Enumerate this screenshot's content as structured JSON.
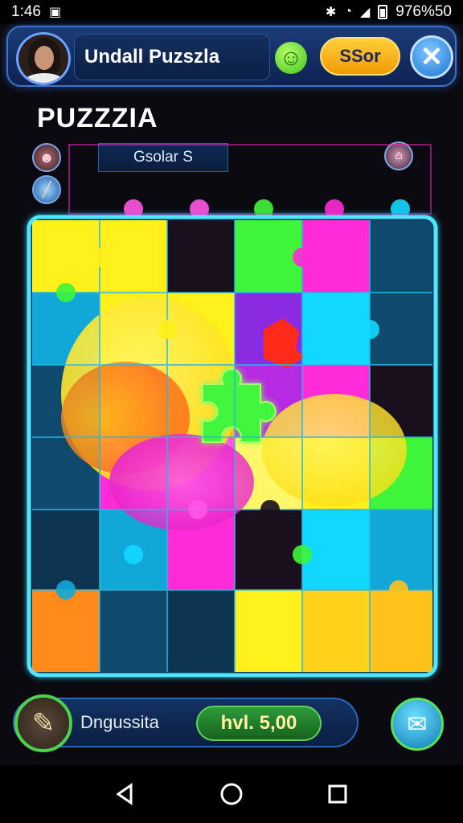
{
  "status_bar": {
    "time": "1:46",
    "right_text": "976%50",
    "icons": [
      "notification-icon",
      "bluetooth-icon",
      "wifi-icon",
      "signal-icon",
      "battery-icon"
    ]
  },
  "header": {
    "title": "Undall Puzszla",
    "score_button_label": "SSor",
    "close_icon": "close-icon",
    "smile_icon": "smile-icon"
  },
  "page_title": "PUZZZIA",
  "search_tag": "Gsolar S",
  "board": {
    "rows": 6,
    "cols": 6,
    "colors": {
      "yellow": "#ffef1a",
      "cyan": "#11d8ff",
      "magenta": "#ff2ad8",
      "green": "#3ff53a",
      "orange": "#ff8a1a",
      "purple": "#8a2be2",
      "dark": "#1a0f1c",
      "red": "#ff2a1a"
    },
    "loose_pieces": [
      "green-piece",
      "red-piece"
    ]
  },
  "bottom_bar": {
    "label": "Dngussita",
    "level_text": "hvl. 5,00",
    "tool_icon": "brush-icon",
    "mail_icon": "mail-icon"
  },
  "nav_bar": {
    "keys": [
      "back-icon",
      "home-icon",
      "recents-icon"
    ]
  }
}
